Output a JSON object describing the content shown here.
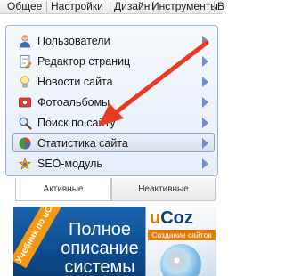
{
  "menubar": {
    "items": [
      "Общее",
      "Настройки",
      "Дизайн",
      "Инструменты",
      "В"
    ]
  },
  "modules": [
    {
      "label": "Пользователи",
      "icon": "user-icon"
    },
    {
      "label": "Редактор страниц",
      "icon": "document-edit-icon"
    },
    {
      "label": "Новости сайта",
      "icon": "lightbulb-icon"
    },
    {
      "label": "Фотоальбомы",
      "icon": "photo-icon"
    },
    {
      "label": "Поиск по сайту",
      "icon": "magnifier-icon"
    },
    {
      "label": "Статистика сайта",
      "icon": "pie-chart-icon",
      "selected": true
    },
    {
      "label": "SEO-модуль",
      "icon": "seo-icon"
    }
  ],
  "tabs": {
    "active": "Активные",
    "inactive": "Неактивные"
  },
  "banner": {
    "ribbon": "Учебник по uCoz",
    "line1": "Полное",
    "line2": "описание",
    "line3": "системы",
    "brand": "uCoz",
    "subtitle": "Создание сайтов"
  },
  "colors": {
    "accent": "#6e8fcf",
    "arrow": "#e83b26",
    "banner": "#1b63aa",
    "ribbon": "#f39a12"
  }
}
